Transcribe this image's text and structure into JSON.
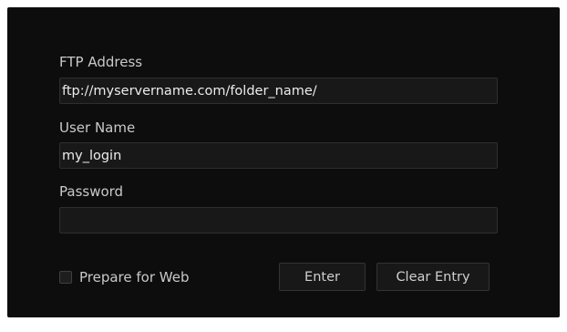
{
  "colors": {
    "panel_background": "#0d0d0d",
    "field_background": "#181818",
    "label_text": "#c9c9c9",
    "value_text": "#ececec"
  },
  "form": {
    "ftp_address": {
      "label": "FTP Address",
      "value": "ftp://myservername.com/folder_name/"
    },
    "user_name": {
      "label": "User Name",
      "value": "my_login"
    },
    "password": {
      "label": "Password",
      "value": ""
    },
    "prepare_for_web": {
      "label": "Prepare for Web",
      "checked": false
    },
    "buttons": {
      "enter": "Enter",
      "clear_entry": "Clear Entry"
    }
  }
}
